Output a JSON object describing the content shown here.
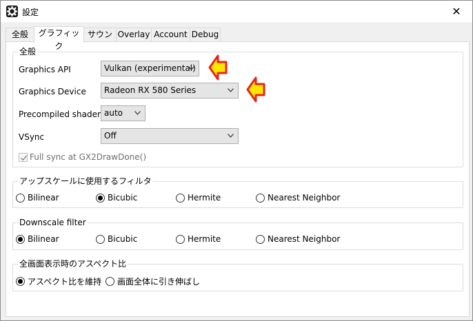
{
  "window": {
    "title": "設定",
    "close_glyph": "✕",
    "icon": "gear-icon"
  },
  "tabs": [
    {
      "label": "全般",
      "active": false
    },
    {
      "label": "グラフィック",
      "active": true
    },
    {
      "label": "サウンド",
      "active": false
    },
    {
      "label": "Overlay",
      "active": false
    },
    {
      "label": "Account",
      "active": false
    },
    {
      "label": "Debug",
      "active": false
    }
  ],
  "general": {
    "title": "全般",
    "graphics_api": {
      "label": "Graphics API",
      "value": "Vulkan (experimental)"
    },
    "graphics_device": {
      "label": "Graphics Device",
      "value": "Radeon RX 580 Series"
    },
    "precompiled_shaders": {
      "label": "Precompiled shaders",
      "value": "auto"
    },
    "vsync": {
      "label": "VSync",
      "value": "Off"
    },
    "full_sync": {
      "label": "Full sync at GX2DrawDone()",
      "checked": true,
      "disabled": true
    }
  },
  "upscale": {
    "title": "アップスケールに使用するフィルタ",
    "options": [
      "Bilinear",
      "Bicubic",
      "Hermite",
      "Nearest Neighbor"
    ],
    "selected": "Bicubic"
  },
  "downscale": {
    "title": "Downscale filter",
    "options": [
      "Bilinear",
      "Bicubic",
      "Hermite",
      "Nearest Neighbor"
    ],
    "selected": "Bilinear"
  },
  "aspect": {
    "title": "全画面表示時のアスペクト比",
    "options": [
      "アスペクト比を維持",
      "画面全体に引き伸ばし"
    ],
    "selected": "アスペクト比を維持"
  },
  "colors": {
    "arrow_fill": "#ffe600",
    "arrow_stroke": "#e8231c"
  }
}
